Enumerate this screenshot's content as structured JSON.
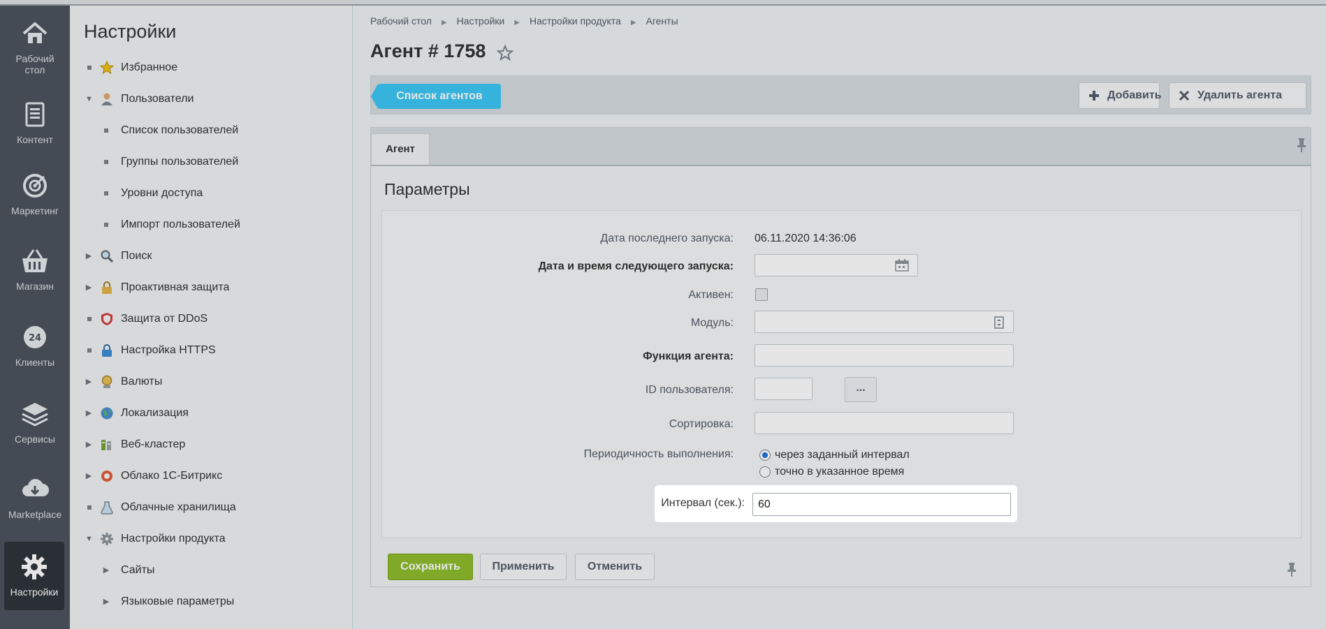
{
  "leftbar": {
    "items": [
      {
        "label": "Рабочий стол",
        "icon": "home-icon"
      },
      {
        "label": "Контент",
        "icon": "document-icon"
      },
      {
        "label": "Маркетинг",
        "icon": "target-icon"
      },
      {
        "label": "Магазин",
        "icon": "basket-icon"
      },
      {
        "label": "Клиенты",
        "icon": "clock-24-icon"
      },
      {
        "label": "Сервисы",
        "icon": "layers-icon"
      },
      {
        "label": "Marketplace",
        "icon": "cloud-download-icon"
      },
      {
        "label": "Настройки",
        "icon": "gear-icon"
      }
    ],
    "home_line1": "Рабочий",
    "home_line2": "стол",
    "clock_number": "24",
    "active": "Настройки"
  },
  "menu": {
    "title": "Настройки",
    "items": [
      {
        "label": "Избранное",
        "icon": "star-icon"
      },
      {
        "label": "Пользователи",
        "icon": "user-icon"
      },
      {
        "label": "Список пользователей"
      },
      {
        "label": "Группы пользователей"
      },
      {
        "label": "Уровни доступа"
      },
      {
        "label": "Импорт пользователей"
      },
      {
        "label": "Поиск",
        "icon": "search-icon"
      },
      {
        "label": "Проактивная защита",
        "icon": "lock-icon"
      },
      {
        "label": "Защита от DDoS",
        "icon": "shield-icon"
      },
      {
        "label": "Настройка HTTPS",
        "icon": "https-lock-icon"
      },
      {
        "label": "Валюты",
        "icon": "coin-icon"
      },
      {
        "label": "Локализация",
        "icon": "globe-icon"
      },
      {
        "label": "Веб-кластер",
        "icon": "cluster-icon"
      },
      {
        "label": "Облако 1С-Битрикс",
        "icon": "cloud-icon"
      },
      {
        "label": "Облачные хранилища",
        "icon": "storage-icon"
      },
      {
        "label": "Настройки продукта",
        "icon": "settings-icon"
      },
      {
        "label": "Сайты"
      },
      {
        "label": "Языковые параметры"
      }
    ]
  },
  "breadcrumbs": [
    "Рабочий стол",
    "Настройки",
    "Настройки продукта",
    "Агенты"
  ],
  "page_title": "Агент # 1758",
  "toolbar": {
    "list_label": "Список агентов",
    "add_label": "Добавить",
    "delete_label": "Удалить агента"
  },
  "tab": {
    "label": "Агент"
  },
  "form": {
    "section_title": "Параметры",
    "last_run_label": "Дата последнего запуска:",
    "last_run_value": "06.11.2020 14:36:06",
    "next_run_label": "Дата и время следующего запуска:",
    "next_run_value": "",
    "active_label": "Активен:",
    "module_label": "Модуль:",
    "module_value": "",
    "function_label": "Функция агента:",
    "function_value": "",
    "user_id_label": "ID пользователя:",
    "user_id_value": "",
    "user_pick_label": "...",
    "sort_label": "Сортировка:",
    "sort_value": "",
    "period_label": "Периодичность выполнения:",
    "period_option_1": "через заданный интервал",
    "period_option_2": "точно в указанное время",
    "interval_label": "Интервал (сек.):",
    "interval_value": "60"
  },
  "footer": {
    "save_label": "Сохранить",
    "apply_label": "Применить",
    "cancel_label": "Отменить"
  },
  "colors": {
    "accent": "#3bc8f5",
    "save": "#8ebd2b",
    "leftbar": "#4d545e"
  }
}
